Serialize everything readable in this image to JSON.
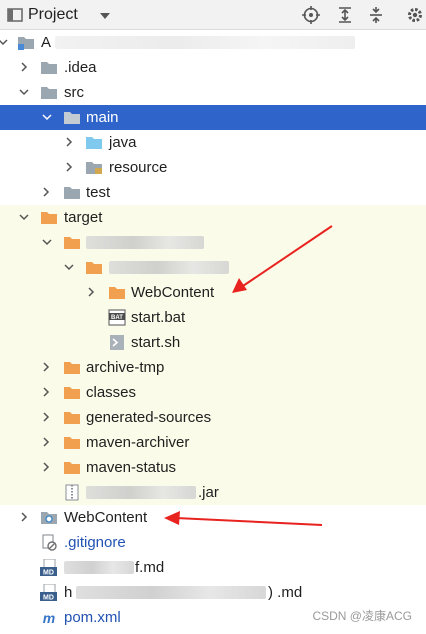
{
  "toolbar": {
    "view_label": "Project",
    "icons": [
      "project-view-icon",
      "chevron-down-icon",
      "locate-icon",
      "expand-all-icon",
      "collapse-all-icon",
      "settings-icon"
    ]
  },
  "tree": {
    "root_label": "A",
    "idea_label": ".idea",
    "src_label": "src",
    "main_label": "main",
    "java_label": "java",
    "resource_label": "resource",
    "test_label": "test",
    "target_label": "target",
    "webcontent_inner_label": "WebContent",
    "start_bat_label": "start.bat",
    "start_sh_label": "start.sh",
    "archive_tmp_label": "archive-tmp",
    "classes_label": "classes",
    "generated_sources_label": "generated-sources",
    "maven_archiver_label": "maven-archiver",
    "maven_status_label": "maven-status",
    "jar_suffix": ".jar",
    "webcontent_label": "WebContent",
    "gitignore_label": ".gitignore",
    "md1_suffix": "f.md",
    "md2_prefix": "h",
    "md2_suffix": ")  .md",
    "pom_label": "pom.xml",
    "md_icon_text": "MD",
    "bat_icon_text": "BAT"
  },
  "watermark": "CSDN @凌康ACG",
  "colors": {
    "selection": "#2f65ca",
    "excluded_bg": "#fbfbe9",
    "folder_gray": "#9aa7b0",
    "folder_orange": "#f1a050",
    "source_folder_blue": "#7fc8ee",
    "arrow_red": "#e8231f"
  }
}
